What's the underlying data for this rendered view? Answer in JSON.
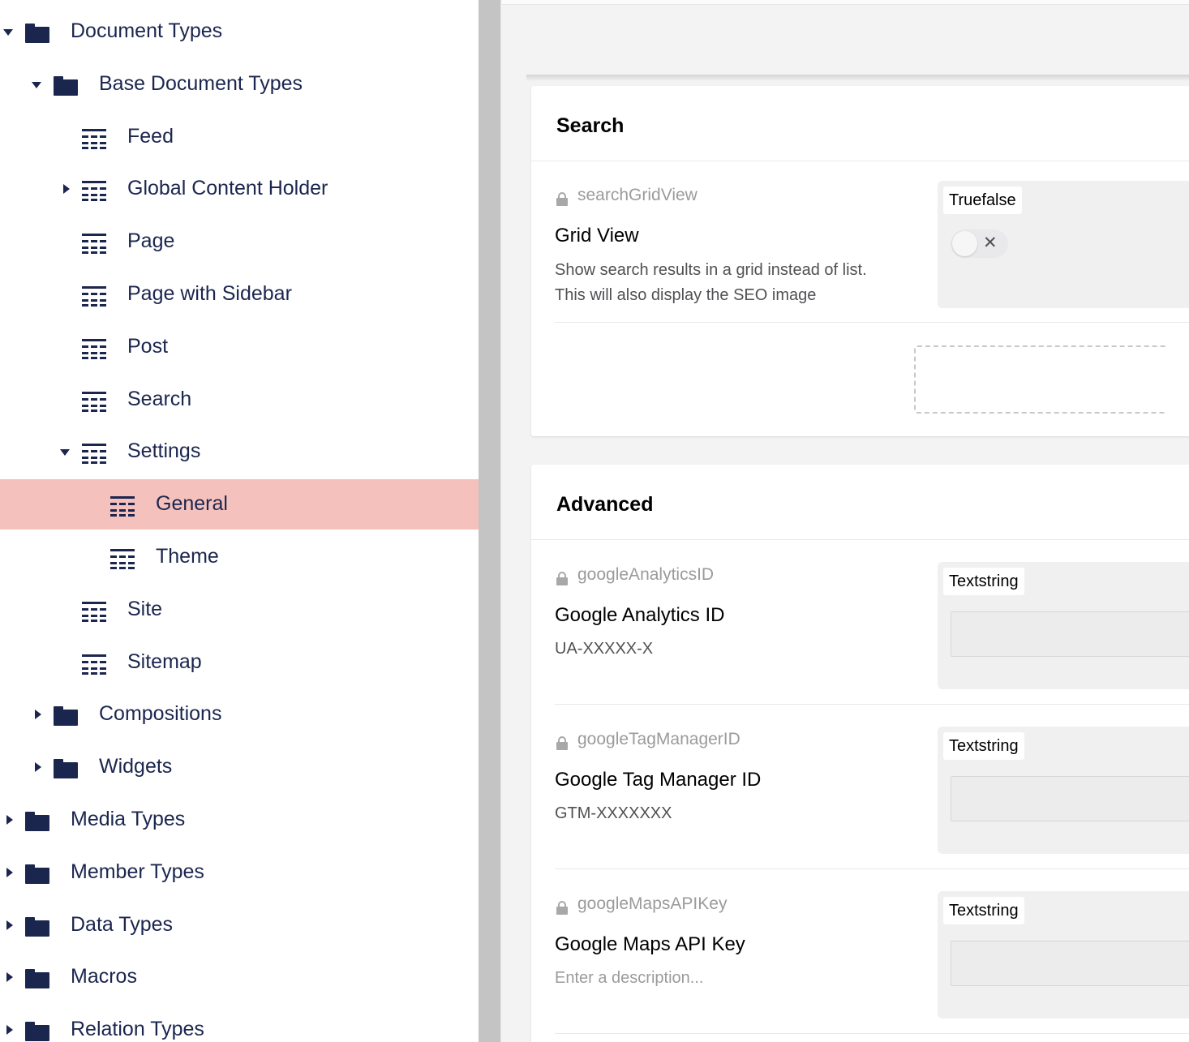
{
  "tree": {
    "items": [
      {
        "label": "Document Types",
        "icon": "folder-icon",
        "caret": "expanded"
      },
      {
        "label": "Base Document Types",
        "icon": "folder-icon",
        "caret": "expanded"
      },
      {
        "label": "Feed",
        "icon": "document-type-icon",
        "caret": "none"
      },
      {
        "label": "Global Content Holder",
        "icon": "document-type-icon",
        "caret": "collapsed"
      },
      {
        "label": "Page",
        "icon": "document-type-icon",
        "caret": "none"
      },
      {
        "label": "Page with Sidebar",
        "icon": "document-type-icon",
        "caret": "none"
      },
      {
        "label": "Post",
        "icon": "document-type-icon",
        "caret": "none"
      },
      {
        "label": "Search",
        "icon": "document-type-icon",
        "caret": "none"
      },
      {
        "label": "Settings",
        "icon": "document-type-icon",
        "caret": "expanded"
      },
      {
        "label": "General",
        "icon": "document-type-icon",
        "caret": "none",
        "selected": true
      },
      {
        "label": "Theme",
        "icon": "document-type-icon",
        "caret": "none"
      },
      {
        "label": "Site",
        "icon": "document-type-icon",
        "caret": "none"
      },
      {
        "label": "Sitemap",
        "icon": "document-type-icon",
        "caret": "none"
      },
      {
        "label": "Compositions",
        "icon": "folder-icon",
        "caret": "collapsed"
      },
      {
        "label": "Widgets",
        "icon": "folder-icon",
        "caret": "collapsed"
      },
      {
        "label": "Media Types",
        "icon": "folder-icon",
        "caret": "collapsed"
      },
      {
        "label": "Member Types",
        "icon": "folder-icon",
        "caret": "collapsed"
      },
      {
        "label": "Data Types",
        "icon": "folder-icon",
        "caret": "collapsed"
      },
      {
        "label": "Macros",
        "icon": "folder-icon",
        "caret": "collapsed"
      },
      {
        "label": "Relation Types",
        "icon": "folder-icon",
        "caret": "collapsed"
      }
    ],
    "selected_color": "#f5c1bc",
    "icon_color": "#1b264f"
  },
  "search_group": {
    "title": "Search",
    "properties": [
      {
        "alias": "searchGridView",
        "name": "Grid View",
        "description_lines": [
          "Show search results in a grid instead of list.",
          "This will also display the SEO image"
        ],
        "editor": "Truefalse",
        "toggle_on": false,
        "toggle_off_symbol": "✕"
      }
    ]
  },
  "advanced_group": {
    "title": "Advanced",
    "properties": [
      {
        "alias": "googleAnalyticsID",
        "name": "Google Analytics ID",
        "description": "UA-XXXXX-X",
        "editor": "Textstring",
        "value": ""
      },
      {
        "alias": "googleTagManagerID",
        "name": "Google Tag Manager ID",
        "description": "GTM-XXXXXXX",
        "editor": "Textstring",
        "value": ""
      },
      {
        "alias": "googleMapsAPIKey",
        "name": "Google Maps API Key",
        "description_placeholder": "Enter a description...",
        "editor": "Textstring",
        "value": ""
      }
    ]
  }
}
